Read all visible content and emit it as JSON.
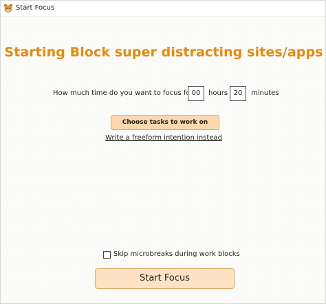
{
  "window": {
    "title": "Start Focus",
    "icon": "bear-face-icon"
  },
  "heading": "Starting Block super distracting sites/apps",
  "focus_time": {
    "question": "How much time do you want to focus for?",
    "hours_value": "00",
    "hours_label": "hours",
    "minutes_value": "20",
    "minutes_label": "minutes"
  },
  "choose_tasks_label": "Choose tasks to work on",
  "freeform_link_label": "Write a freeform intention instead",
  "skip_microbreaks": {
    "label": "Skip microbreaks during work blocks",
    "checked": false
  },
  "start_button_label": "Start Focus",
  "colors": {
    "heading": "#e58a0f",
    "button_fill": "#fcd8ae",
    "button_border": "#e6a965"
  }
}
